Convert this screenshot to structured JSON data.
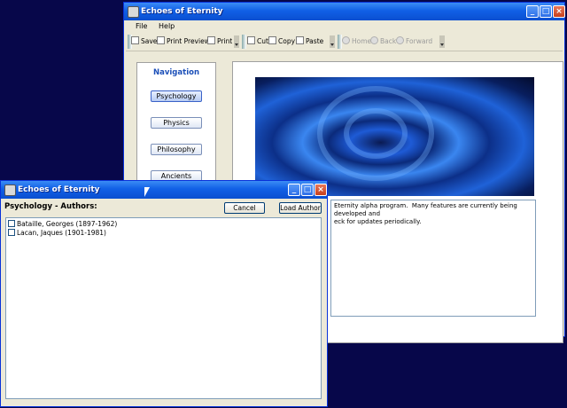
{
  "main_window": {
    "title": "Echoes of Eternity",
    "menu": [
      "File",
      "Help"
    ],
    "toolbar": {
      "save": "Save",
      "print_preview": "Print Preview",
      "print": "Print",
      "cut": "Cut",
      "copy": "Copy",
      "paste": "Paste",
      "home": "Home",
      "back": "Back",
      "forward": "Forward"
    },
    "navigation": {
      "title": "Navigation",
      "items": [
        "Psychology",
        "Physics",
        "Philosophy",
        "Ancients"
      ]
    },
    "message": "Eternity alpha program.  Many features are currently being developed and\neck for updates periodically."
  },
  "dialog": {
    "title": "Echoes of Eternity",
    "heading": "Psychology - Authors:",
    "cancel_label": "Cancel",
    "load_label": "Load Author",
    "authors": [
      "Bataille, Georges (1897-1962)",
      "Lacan, Jaques (1901-1981)"
    ]
  }
}
